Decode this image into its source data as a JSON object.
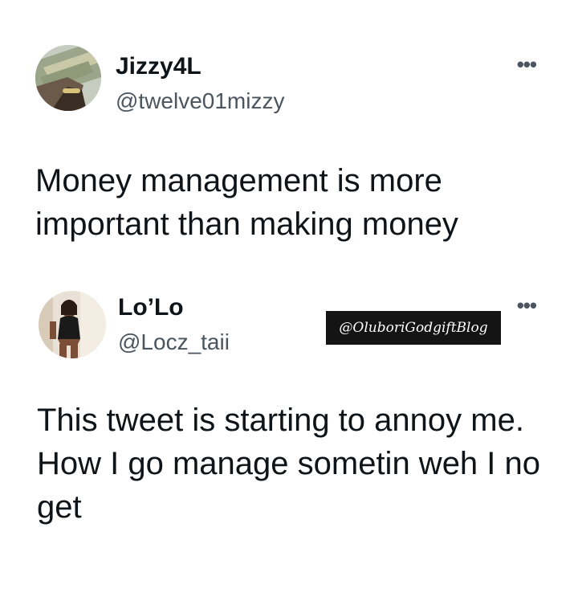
{
  "tweets": [
    {
      "display_name": "Jizzy4L",
      "handle": "@twelve01mizzy",
      "text": "Money management is more important than making money",
      "more_icon": "more-horizontal-icon"
    },
    {
      "display_name": "Lo’Lo",
      "handle": "@Locz_taii",
      "text": "This tweet is starting to annoy me. How I go manage sometin weh I no get",
      "more_icon": "more-horizontal-icon"
    }
  ],
  "watermark": "@OluboriGodgiftBlog"
}
